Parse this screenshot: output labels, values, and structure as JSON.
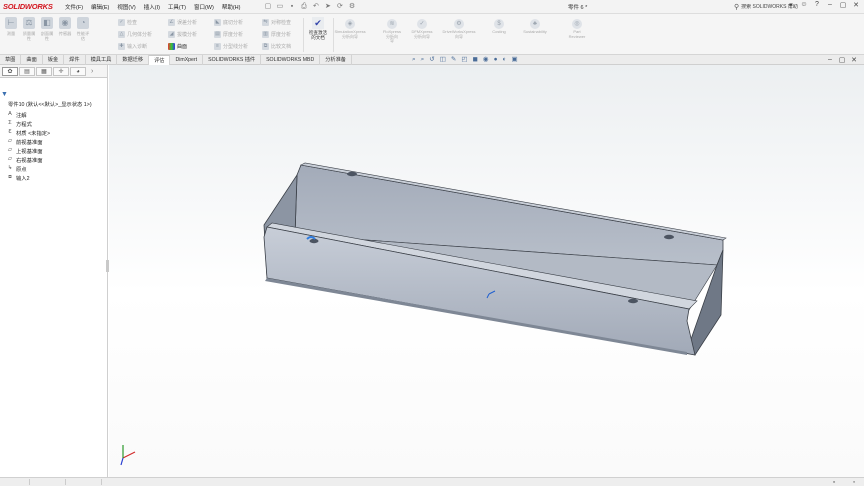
{
  "app": {
    "logo": "SOLIDWORKS",
    "doc_title": "零件 6 *"
  },
  "menu": [
    "文件(F)",
    "编辑(E)",
    "视图(V)",
    "插入(I)",
    "工具(T)",
    "窗口(W)",
    "帮助(H)"
  ],
  "search": {
    "placeholder": "搜索 SOLIDWORKS 帮助"
  },
  "ribbon": {
    "big_buttons": [
      {
        "label": "测量",
        "icon": "ruler-icon"
      },
      {
        "label": "质量属\n性",
        "icon": "scale-icon"
      },
      {
        "label": "剖面属\n性",
        "icon": "section-icon"
      },
      {
        "label": "传感器",
        "icon": "sensor-icon"
      },
      {
        "label": "性能评\n估",
        "icon": "gauge-icon"
      }
    ],
    "small_col1": [
      "检查",
      "几何体分析",
      "输入诊断"
    ],
    "small_col2": [
      "误差分析",
      "拔模分析",
      "曲面"
    ],
    "small_col3": [
      "底切分析",
      "厚度分析",
      "分型线分析"
    ],
    "small_col4": [
      "对称检查",
      "厚度分析",
      "比较文档"
    ],
    "check_active": "检查激活\n的文档",
    "addins": [
      "SimulationXpress\n分析向导",
      "FloXpress\n分析向\n导",
      "DFMXpress\n分析向导",
      "DriveWorksXpress\n向导",
      "Costing",
      "Sustainability",
      "Part\nReviewer"
    ]
  },
  "tabs": [
    {
      "label": "草图",
      "active": false
    },
    {
      "label": "曲面",
      "active": false
    },
    {
      "label": "钣金",
      "active": false
    },
    {
      "label": "焊件",
      "active": false
    },
    {
      "label": "模具工具",
      "active": false
    },
    {
      "label": "数据迁移",
      "active": false
    },
    {
      "label": "评估",
      "active": true
    },
    {
      "label": "DimXpert",
      "active": false
    },
    {
      "label": "SOLIDWORKS 插件",
      "active": false
    },
    {
      "label": "SOLIDWORKS MBD",
      "active": false
    },
    {
      "label": "分析准备",
      "active": false
    }
  ],
  "tree": {
    "root": "零件10 (默认<<默认>_显示状态 1>)",
    "items": [
      {
        "label": "注解",
        "icon": "annotation-icon"
      },
      {
        "label": "方程式",
        "icon": "equation-icon"
      },
      {
        "label": "材质 <未指定>",
        "icon": "material-icon"
      },
      {
        "label": "前视基准面",
        "icon": "plane-icon"
      },
      {
        "label": "上视基准面",
        "icon": "plane-icon"
      },
      {
        "label": "右视基准面",
        "icon": "plane-icon"
      },
      {
        "label": "原点",
        "icon": "origin-icon"
      },
      {
        "label": "输入2",
        "icon": "body-icon"
      }
    ]
  },
  "colors": {
    "brand": "#d3141e",
    "model_face": "#a8b0be",
    "model_dark": "#6d7684",
    "model_light": "#c2c8d3"
  }
}
